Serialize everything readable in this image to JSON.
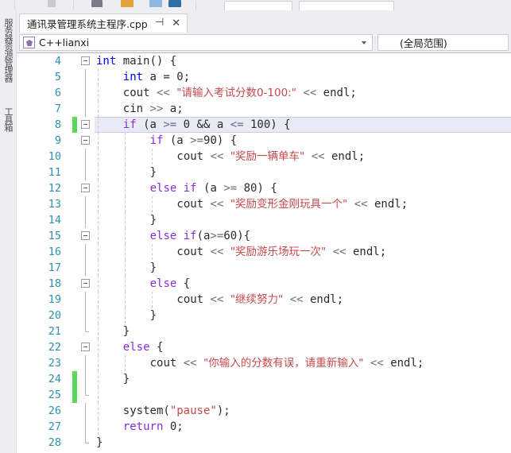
{
  "window": {
    "accent_current_line": "#e8eaf6",
    "changebar_color": "#5ad65a",
    "linenumber_color": "#2b91af",
    "string_color": "#c6484b",
    "keyword_color": "#0000ff",
    "control_keyword_color": "#8a2be2"
  },
  "left_dock": {
    "tabs": [
      {
        "label": "服务器资源管理器",
        "name": "server-explorer"
      },
      {
        "label": "工具箱",
        "name": "toolbox"
      }
    ]
  },
  "tabstrip": {
    "active_tab": {
      "title": "通讯录管理系统主程序.cpp",
      "pin_glyph": "⊣",
      "close_glyph": "✕"
    }
  },
  "navbar": {
    "project_combo": {
      "value": "C++lianxi",
      "icon": "cpp-project-icon"
    },
    "scope_combo": {
      "value": "(全局范围)"
    }
  },
  "editor": {
    "lines": [
      {
        "num": "4",
        "change": false,
        "fold": "open",
        "outline": "none",
        "guides": [],
        "tokens": [
          {
            "t": "int",
            "c": "type"
          },
          {
            "t": " ",
            "c": "pl"
          },
          {
            "t": "main",
            "c": "fn"
          },
          {
            "t": "() {",
            "c": "pl"
          }
        ],
        "indent": 0
      },
      {
        "num": "5",
        "change": false,
        "fold": "none",
        "outline": "line",
        "guides": [
          1
        ],
        "tokens": [
          {
            "t": "int",
            "c": "type"
          },
          {
            "t": " a = ",
            "c": "pl"
          },
          {
            "t": "0",
            "c": "num"
          },
          {
            "t": ";",
            "c": "pl"
          }
        ],
        "indent": 1
      },
      {
        "num": "6",
        "change": false,
        "fold": "none",
        "outline": "line",
        "guides": [
          1
        ],
        "tokens": [
          {
            "t": "cout ",
            "c": "pl"
          },
          {
            "t": "<<",
            "c": "op"
          },
          {
            "t": " ",
            "c": "pl"
          },
          {
            "t": "\"请输入考试分数0-100:\"",
            "c": "str han"
          },
          {
            "t": " ",
            "c": "pl"
          },
          {
            "t": "<<",
            "c": "op"
          },
          {
            "t": " endl;",
            "c": "pl"
          }
        ],
        "indent": 1
      },
      {
        "num": "7",
        "change": false,
        "fold": "none",
        "outline": "line",
        "guides": [
          1
        ],
        "tokens": [
          {
            "t": "cin ",
            "c": "pl"
          },
          {
            "t": ">>",
            "c": "op"
          },
          {
            "t": " a;",
            "c": "pl"
          }
        ],
        "indent": 1
      },
      {
        "num": "8",
        "change": true,
        "fold": "open",
        "outline": "none",
        "current": true,
        "guides": [
          1
        ],
        "tokens": [
          {
            "t": "if",
            "c": "kw2"
          },
          {
            "t": " (a ",
            "c": "pl"
          },
          {
            "t": ">=",
            "c": "op"
          },
          {
            "t": " ",
            "c": "pl"
          },
          {
            "t": "0",
            "c": "num"
          },
          {
            "t": " && a ",
            "c": "pl"
          },
          {
            "t": "<=",
            "c": "op"
          },
          {
            "t": " ",
            "c": "pl"
          },
          {
            "t": "100",
            "c": "num"
          },
          {
            "t": ") {",
            "c": "pl"
          }
        ],
        "indent": 1
      },
      {
        "num": "9",
        "change": false,
        "fold": "open",
        "outline": "none",
        "guides": [
          1,
          2
        ],
        "tokens": [
          {
            "t": "if",
            "c": "kw2"
          },
          {
            "t": " (a ",
            "c": "pl"
          },
          {
            "t": ">=",
            "c": "op"
          },
          {
            "t": "90",
            "c": "num"
          },
          {
            "t": ") {",
            "c": "pl"
          }
        ],
        "indent": 2
      },
      {
        "num": "10",
        "change": false,
        "fold": "none",
        "outline": "line",
        "guides": [
          1,
          2,
          3
        ],
        "tokens": [
          {
            "t": "cout ",
            "c": "pl"
          },
          {
            "t": "<<",
            "c": "op"
          },
          {
            "t": " ",
            "c": "pl"
          },
          {
            "t": "\"奖励一辆单车\"",
            "c": "str han"
          },
          {
            "t": " ",
            "c": "pl"
          },
          {
            "t": "<<",
            "c": "op"
          },
          {
            "t": " endl;",
            "c": "pl"
          }
        ],
        "indent": 3
      },
      {
        "num": "11",
        "change": false,
        "fold": "none",
        "outline": "line",
        "guides": [
          1,
          2
        ],
        "tokens": [
          {
            "t": "}",
            "c": "pl"
          }
        ],
        "indent": 2
      },
      {
        "num": "12",
        "change": false,
        "fold": "open",
        "outline": "none",
        "guides": [
          1,
          2
        ],
        "tokens": [
          {
            "t": "else",
            "c": "kw2"
          },
          {
            "t": " ",
            "c": "pl"
          },
          {
            "t": "if",
            "c": "kw2"
          },
          {
            "t": " (a ",
            "c": "pl"
          },
          {
            "t": ">=",
            "c": "op"
          },
          {
            "t": " ",
            "c": "pl"
          },
          {
            "t": "80",
            "c": "num"
          },
          {
            "t": ") {",
            "c": "pl"
          }
        ],
        "indent": 2
      },
      {
        "num": "13",
        "change": false,
        "fold": "none",
        "outline": "line",
        "guides": [
          1,
          2,
          3
        ],
        "tokens": [
          {
            "t": "cout ",
            "c": "pl"
          },
          {
            "t": "<<",
            "c": "op"
          },
          {
            "t": " ",
            "c": "pl"
          },
          {
            "t": "\"奖励变形金刚玩具一个\"",
            "c": "str han"
          },
          {
            "t": " ",
            "c": "pl"
          },
          {
            "t": "<<",
            "c": "op"
          },
          {
            "t": " endl;",
            "c": "pl"
          }
        ],
        "indent": 3
      },
      {
        "num": "14",
        "change": false,
        "fold": "none",
        "outline": "line",
        "guides": [
          1,
          2
        ],
        "tokens": [
          {
            "t": "}",
            "c": "pl"
          }
        ],
        "indent": 2
      },
      {
        "num": "15",
        "change": false,
        "fold": "open",
        "outline": "none",
        "guides": [
          1,
          2
        ],
        "tokens": [
          {
            "t": "else",
            "c": "kw2"
          },
          {
            "t": " ",
            "c": "pl"
          },
          {
            "t": "if",
            "c": "kw2"
          },
          {
            "t": "(a",
            "c": "pl"
          },
          {
            "t": ">=",
            "c": "op"
          },
          {
            "t": "60",
            "c": "num"
          },
          {
            "t": "){",
            "c": "pl"
          }
        ],
        "indent": 2
      },
      {
        "num": "16",
        "change": false,
        "fold": "none",
        "outline": "line",
        "guides": [
          1,
          2,
          3
        ],
        "tokens": [
          {
            "t": "cout ",
            "c": "pl"
          },
          {
            "t": "<<",
            "c": "op"
          },
          {
            "t": " ",
            "c": "pl"
          },
          {
            "t": "\"奖励游乐场玩一次\"",
            "c": "str han"
          },
          {
            "t": " ",
            "c": "pl"
          },
          {
            "t": "<<",
            "c": "op"
          },
          {
            "t": " endl;",
            "c": "pl"
          }
        ],
        "indent": 3
      },
      {
        "num": "17",
        "change": false,
        "fold": "none",
        "outline": "line",
        "guides": [
          1,
          2
        ],
        "tokens": [
          {
            "t": "}",
            "c": "pl"
          }
        ],
        "indent": 2
      },
      {
        "num": "18",
        "change": false,
        "fold": "open",
        "outline": "none",
        "guides": [
          1,
          2
        ],
        "tokens": [
          {
            "t": "else",
            "c": "kw2"
          },
          {
            "t": " {",
            "c": "pl"
          }
        ],
        "indent": 2
      },
      {
        "num": "19",
        "change": false,
        "fold": "none",
        "outline": "line",
        "guides": [
          1,
          2,
          3
        ],
        "tokens": [
          {
            "t": "cout ",
            "c": "pl"
          },
          {
            "t": "<<",
            "c": "op"
          },
          {
            "t": " ",
            "c": "pl"
          },
          {
            "t": "\"继续努力\"",
            "c": "str han"
          },
          {
            "t": " ",
            "c": "pl"
          },
          {
            "t": "<<",
            "c": "op"
          },
          {
            "t": " endl;",
            "c": "pl"
          }
        ],
        "indent": 3
      },
      {
        "num": "20",
        "change": false,
        "fold": "none",
        "outline": "line",
        "guides": [
          1,
          2
        ],
        "tokens": [
          {
            "t": "}",
            "c": "pl"
          }
        ],
        "indent": 2
      },
      {
        "num": "21",
        "change": false,
        "fold": "none",
        "outline": "end",
        "guides": [
          1
        ],
        "tokens": [
          {
            "t": "}",
            "c": "pl"
          }
        ],
        "indent": 1
      },
      {
        "num": "22",
        "change": false,
        "fold": "open",
        "outline": "none",
        "guides": [
          1
        ],
        "tokens": [
          {
            "t": "else",
            "c": "kw2"
          },
          {
            "t": " {",
            "c": "pl"
          }
        ],
        "indent": 1
      },
      {
        "num": "23",
        "change": false,
        "fold": "none",
        "outline": "line",
        "guides": [
          1,
          2
        ],
        "tokens": [
          {
            "t": "cout ",
            "c": "pl"
          },
          {
            "t": "<<",
            "c": "op"
          },
          {
            "t": " ",
            "c": "pl"
          },
          {
            "t": "\"你输入的分数有误，请重新输入\"",
            "c": "str han"
          },
          {
            "t": " ",
            "c": "pl"
          },
          {
            "t": "<<",
            "c": "op"
          },
          {
            "t": " endl;",
            "c": "pl"
          }
        ],
        "indent": 2
      },
      {
        "num": "24",
        "change": true,
        "fold": "none",
        "outline": "line",
        "guides": [
          1
        ],
        "tokens": [
          {
            "t": "}",
            "c": "pl"
          }
        ],
        "indent": 1
      },
      {
        "num": "25",
        "change": true,
        "fold": "none",
        "outline": "end",
        "guides": [
          1
        ],
        "tokens": [],
        "indent": 1
      },
      {
        "num": "26",
        "change": false,
        "fold": "none",
        "outline": "line",
        "guides": [
          1
        ],
        "tokens": [
          {
            "t": "system",
            "c": "fn"
          },
          {
            "t": "(",
            "c": "pl"
          },
          {
            "t": "\"pause\"",
            "c": "str"
          },
          {
            "t": ");",
            "c": "pl"
          }
        ],
        "indent": 1
      },
      {
        "num": "27",
        "change": false,
        "fold": "none",
        "outline": "line",
        "guides": [
          1
        ],
        "tokens": [
          {
            "t": "return",
            "c": "kw2"
          },
          {
            "t": " ",
            "c": "pl"
          },
          {
            "t": "0",
            "c": "num"
          },
          {
            "t": ";",
            "c": "pl"
          }
        ],
        "indent": 1
      },
      {
        "num": "28",
        "change": false,
        "fold": "none",
        "outline": "close",
        "guides": [],
        "tokens": [
          {
            "t": "}",
            "c": "pl"
          }
        ],
        "indent": 0
      }
    ]
  }
}
